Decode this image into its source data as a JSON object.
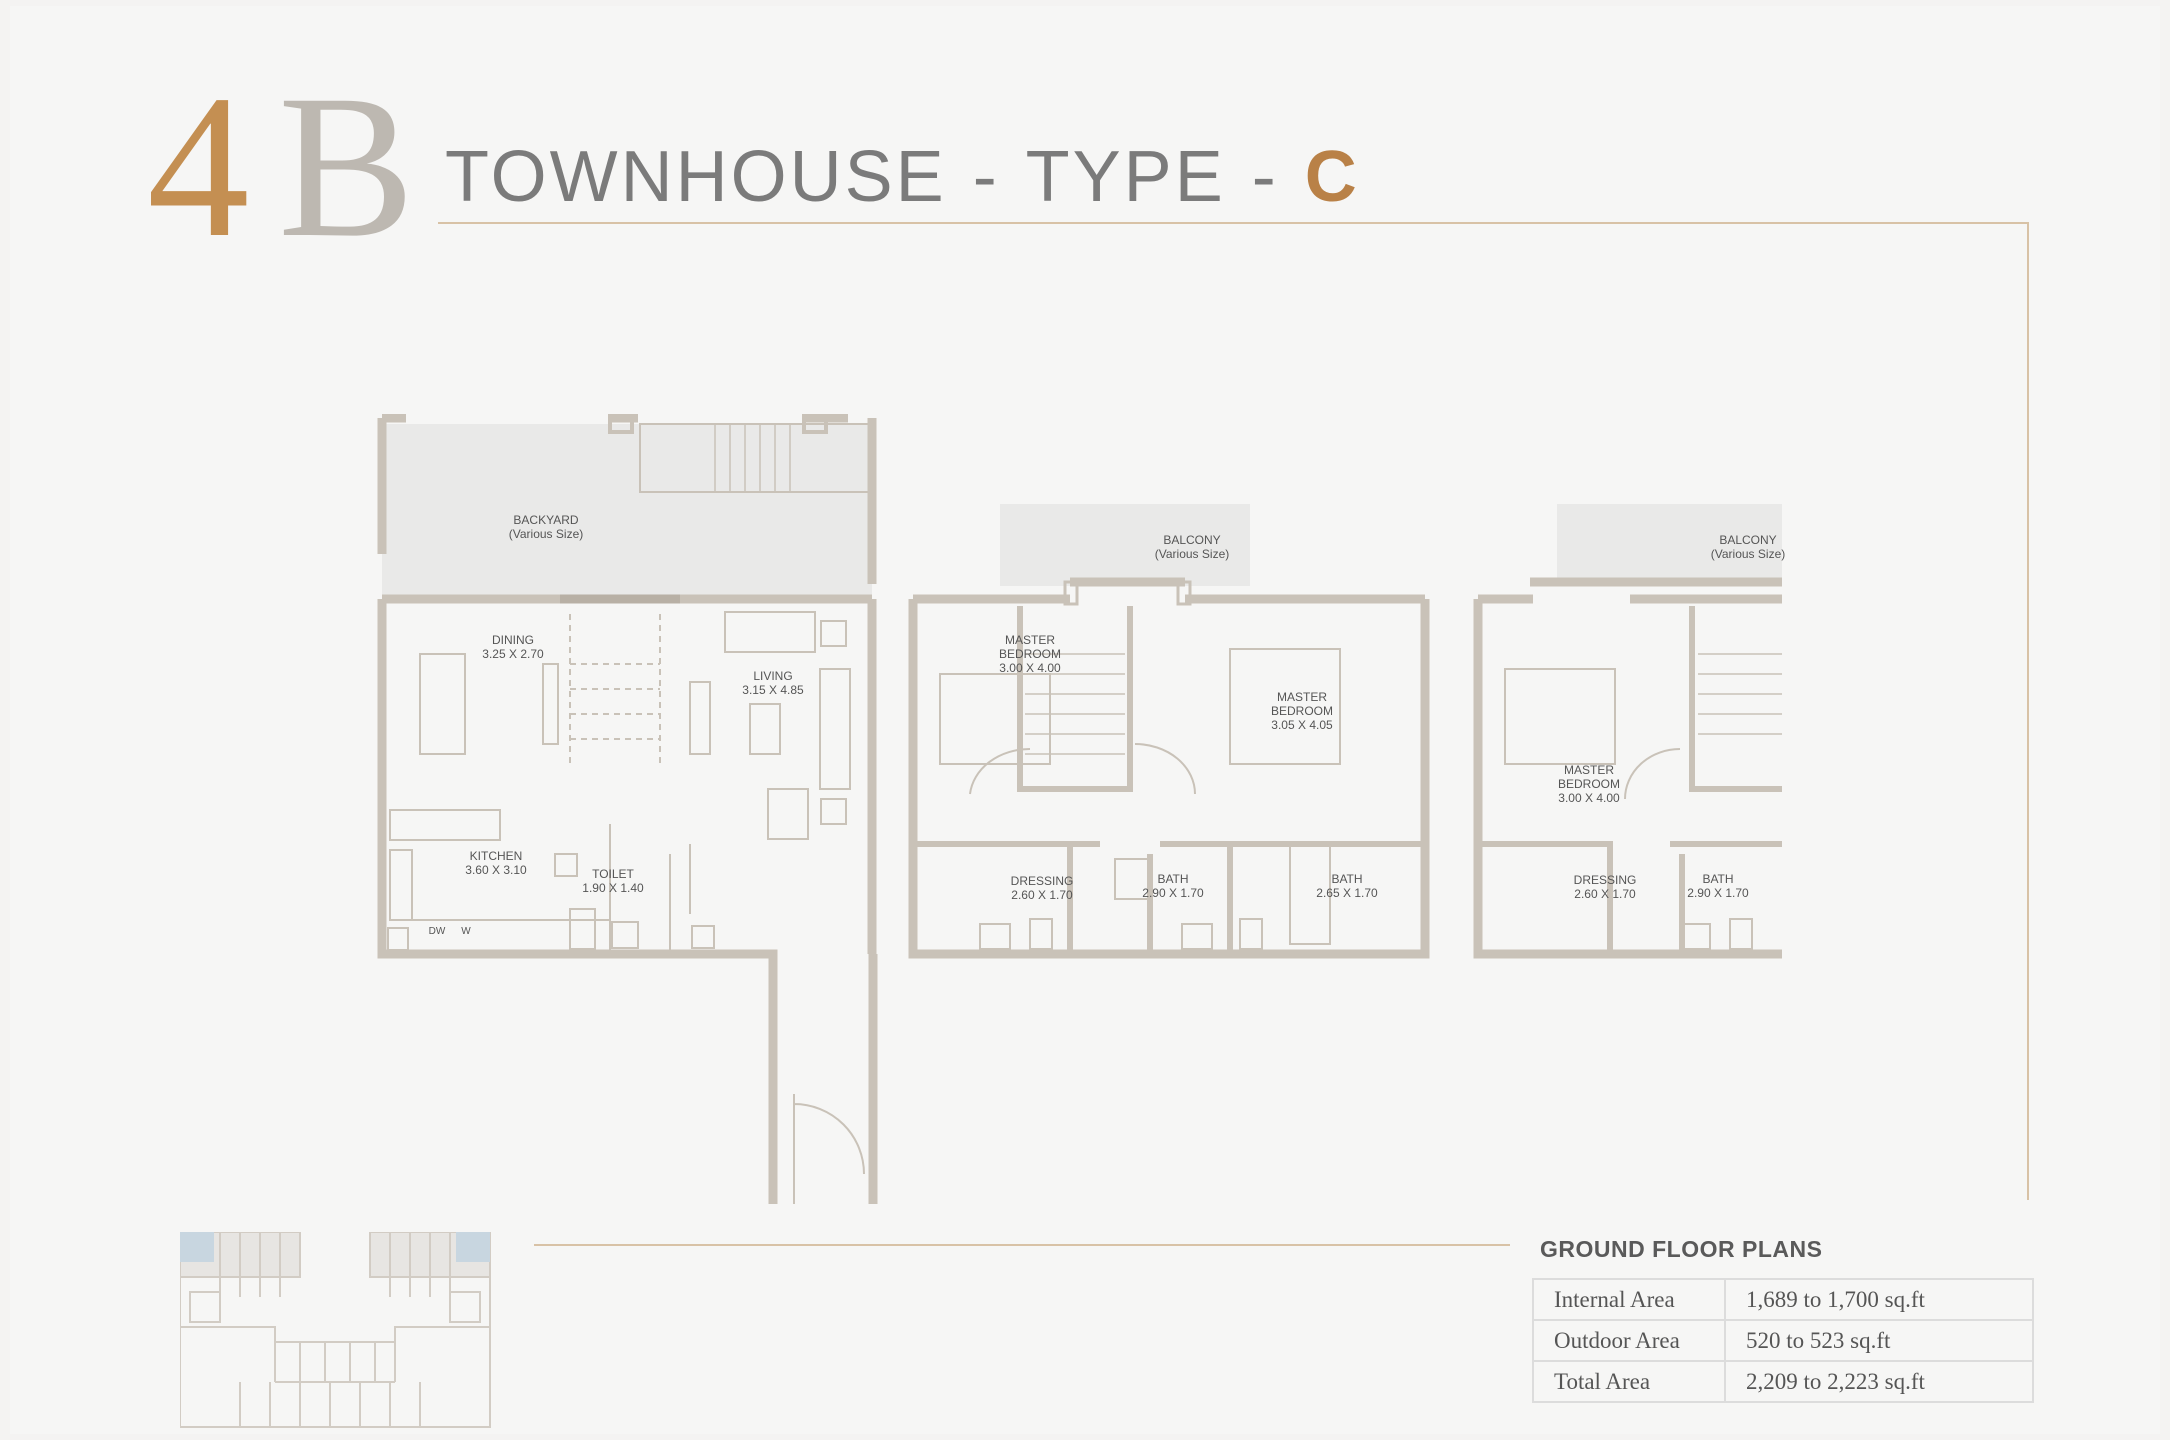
{
  "header": {
    "big_number": "4",
    "big_letter": "B",
    "title_main": "TOWNHOUSE",
    "title_sep1": "-",
    "title_type_word": "TYPE",
    "title_sep2": "-",
    "title_type": "C"
  },
  "plan_labels": {
    "backyard": "BACKYARD",
    "backyard_size": "(Various Size)",
    "dining": "DINING",
    "dining_size": "3.25 X 2.70",
    "living": "LIVING",
    "living_size": "3.15 X 4.85",
    "kitchen": "KITCHEN",
    "kitchen_size": "3.60 X 3.10",
    "toilet": "TOILET",
    "toilet_size": "1.90 X 1.40",
    "dw": "DW",
    "w": "W",
    "balcony1": "BALCONY",
    "balcony1_size": "(Various Size)",
    "master1": "MASTER",
    "master1_b": "BEDROOM",
    "master1_size": "3.00 X 4.00",
    "master2": "MASTER",
    "master2_b": "BEDROOM",
    "master2_size": "3.05 X 4.05",
    "dressing1": "DRESSING",
    "dressing1_size": "2.60 X 1.70",
    "bath1": "BATH",
    "bath1_size": "2.90 X 1.70",
    "bath2": "BATH",
    "bath2_size": "2.65 X 1.70",
    "balcony2": "BALCONY",
    "balcony2_size": "(Various Size)",
    "master3": "MASTER",
    "master3_b": "BEDROOM",
    "master3_size": "3.00 X 4.00",
    "dressing2": "DRESSING",
    "dressing2_size": "2.60 X 1.70",
    "bath3": "BATH",
    "bath3_size": "2.90 X 1.70"
  },
  "areas": {
    "heading": "GROUND FLOOR PLANS",
    "rows": [
      {
        "label": "Internal Area",
        "value": "1,689 to 1,700 sq.ft"
      },
      {
        "label": "Outdoor Area",
        "value": "520 to 523 sq.ft"
      },
      {
        "label": "Total Area",
        "value": "2,209 to 2,223 sq.ft"
      }
    ]
  },
  "colors": {
    "gold": "#c48f52",
    "wall": "#c9c2b8",
    "rule": "#d8c2a6"
  }
}
